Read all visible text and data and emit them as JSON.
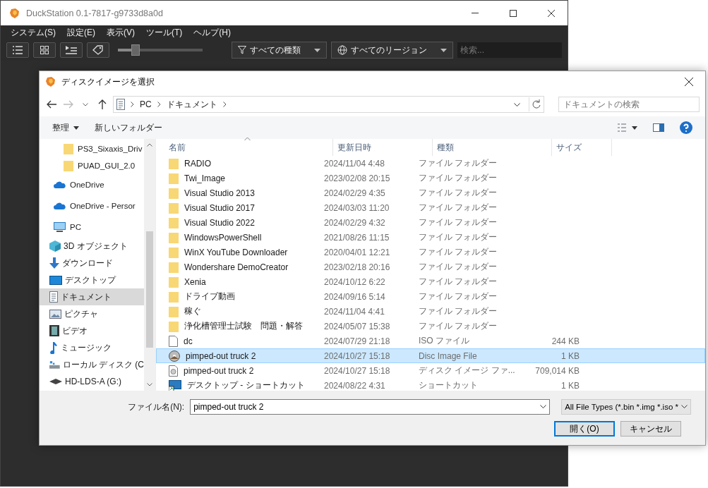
{
  "app": {
    "title": "DuckStation 0.1-7817-g9733d8a0d",
    "menu": [
      "システム(S)",
      "設定(E)",
      "表示(V)",
      "ツール(T)",
      "ヘルプ(H)"
    ],
    "toolbar": {
      "view_buttons": [
        {
          "kind": "list"
        },
        {
          "kind": "grid"
        },
        {
          "kind": "cover"
        },
        {
          "kind": "tag"
        }
      ],
      "zoom": {
        "level": 0.2
      },
      "type_filter": "すべての種類",
      "region_filter": "すべてのリージョン",
      "search": {
        "placeholder": "検索..."
      }
    }
  },
  "dialog": {
    "title": "ディスクイメージを選択",
    "address": [
      "PC",
      "ドキュメント"
    ],
    "search": {
      "placeholder": "ドキュメントの検索"
    },
    "commands": [
      "整理",
      "新しいフォルダー"
    ],
    "nav": [
      {
        "label": "PS3_Sixaxis_Driv",
        "kind": "folder",
        "selected": false
      },
      {
        "label": "PUAD_GUI_2.0",
        "kind": "folder",
        "selected": false
      },
      {
        "label": "OneDrive",
        "kind": "cloud",
        "selected": false
      },
      {
        "label": "OneDrive - Persor",
        "kind": "cloud",
        "selected": false
      },
      {
        "label": "PC",
        "kind": "pc",
        "selected": false,
        "children": [
          {
            "label": "3D オブジェクト",
            "kind": "cube",
            "selected": false
          },
          {
            "label": "ダウンロード",
            "kind": "download",
            "selected": false
          },
          {
            "label": "デスクトップ",
            "kind": "desktop",
            "selected": false
          },
          {
            "label": "ドキュメント",
            "kind": "document",
            "selected": true
          },
          {
            "label": "ピクチャ",
            "kind": "picture",
            "selected": false
          },
          {
            "label": "ビデオ",
            "kind": "video",
            "selected": false
          },
          {
            "label": "ミュージック",
            "kind": "music",
            "selected": false
          },
          {
            "label": "ローカル ディスク (C",
            "kind": "disk",
            "selected": false
          },
          {
            "label": "HD-LDS-A (G:)",
            "kind": "drive",
            "selected": false
          }
        ]
      }
    ],
    "columns": [
      {
        "label": "名前",
        "sorted": true
      },
      {
        "label": "更新日時",
        "sorted": false
      },
      {
        "label": "種類",
        "sorted": false
      },
      {
        "label": "サイズ",
        "sorted": false
      }
    ],
    "rows": [
      {
        "name": "RADIO",
        "modified": "2024/11/04 4:48",
        "type": "ファイル フォルダー",
        "size": "",
        "kind": "folder",
        "selected": false
      },
      {
        "name": "Twi_Image",
        "modified": "2023/02/08 20:15",
        "type": "ファイル フォルダー",
        "size": "",
        "kind": "folder",
        "selected": false
      },
      {
        "name": "Visual Studio 2013",
        "modified": "2024/02/29 4:35",
        "type": "ファイル フォルダー",
        "size": "",
        "kind": "folder",
        "selected": false
      },
      {
        "name": "Visual Studio 2017",
        "modified": "2024/03/03 11:20",
        "type": "ファイル フォルダー",
        "size": "",
        "kind": "folder",
        "selected": false
      },
      {
        "name": "Visual Studio 2022",
        "modified": "2024/02/29 4:32",
        "type": "ファイル フォルダー",
        "size": "",
        "kind": "folder",
        "selected": false
      },
      {
        "name": "WindowsPowerShell",
        "modified": "2021/08/26 11:15",
        "type": "ファイル フォルダー",
        "size": "",
        "kind": "folder",
        "selected": false
      },
      {
        "name": "WinX YouTube Downloader",
        "modified": "2020/04/01 12:21",
        "type": "ファイル フォルダー",
        "size": "",
        "kind": "folder",
        "selected": false
      },
      {
        "name": "Wondershare DemoCreator",
        "modified": "2023/02/18 20:16",
        "type": "ファイル フォルダー",
        "size": "",
        "kind": "folder",
        "selected": false
      },
      {
        "name": "Xenia",
        "modified": "2024/10/12 6:22",
        "type": "ファイル フォルダー",
        "size": "",
        "kind": "folder",
        "selected": false
      },
      {
        "name": "ドライブ動画",
        "modified": "2024/09/16 5:14",
        "type": "ファイル フォルダー",
        "size": "",
        "kind": "folder",
        "selected": false
      },
      {
        "name": "稼ぐ",
        "modified": "2024/11/04 4:41",
        "type": "ファイル フォルダー",
        "size": "",
        "kind": "folder",
        "selected": false
      },
      {
        "name": "浄化槽管理士試験　問題・解答",
        "modified": "2024/05/07 15:38",
        "type": "ファイル フォルダー",
        "size": "",
        "kind": "folder",
        "selected": false
      },
      {
        "name": "dc",
        "modified": "2024/07/29 21:18",
        "type": "ISO ファイル",
        "size": "244 KB",
        "kind": "file",
        "selected": false
      },
      {
        "name": "pimped-out truck 2",
        "modified": "2024/10/27 15:18",
        "type": "Disc Image File",
        "size": "1 KB",
        "kind": "disc",
        "selected": true
      },
      {
        "name": "pimped-out truck 2",
        "modified": "2024/10/27 15:18",
        "type": "ディスク イメージ ファ...",
        "size": "709,014 KB",
        "kind": "iso",
        "selected": false
      },
      {
        "name": "デスクトップ - ショートカット",
        "modified": "2024/08/22 4:31",
        "type": "ショートカット",
        "size": "1 KB",
        "kind": "shortcut",
        "selected": false
      }
    ],
    "filename_label": "ファイル名(N):",
    "filename": "pimped-out truck 2",
    "filetype": "All File Types (*.bin *.img *.iso *",
    "buttons": [
      "開く(O)",
      "キャンセル"
    ]
  }
}
